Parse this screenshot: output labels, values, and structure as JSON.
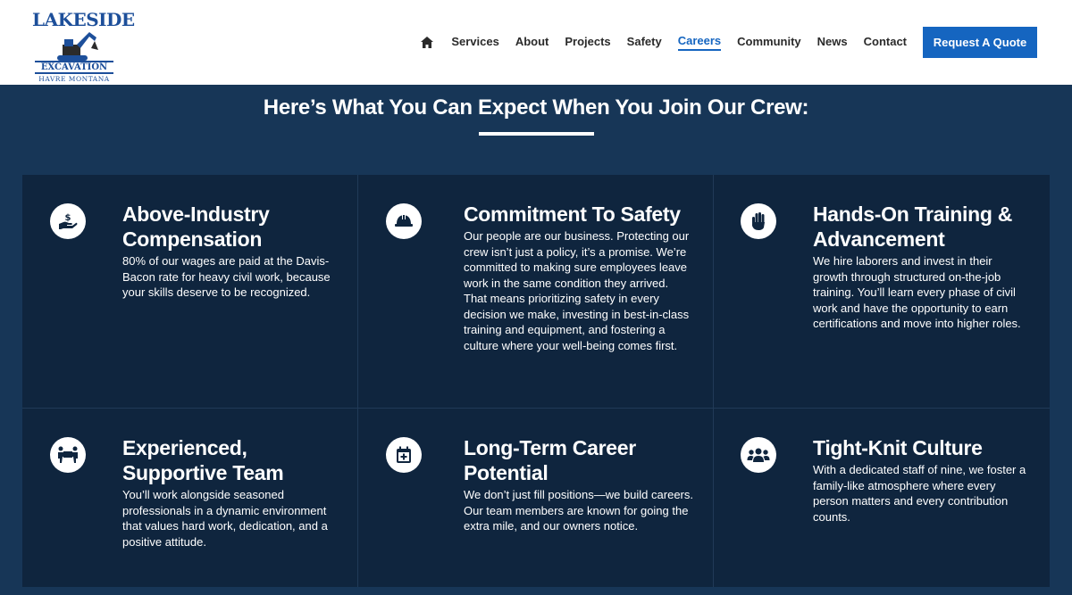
{
  "logo": {
    "top_text": "LAKESIDE",
    "band_text": "EXCAVATION",
    "sub_text": "HAVRE MONTANA"
  },
  "nav": {
    "home_icon": "home-icon",
    "items": [
      {
        "label": "Services"
      },
      {
        "label": "About"
      },
      {
        "label": "Projects"
      },
      {
        "label": "Safety"
      },
      {
        "label": "Careers",
        "active": true
      },
      {
        "label": "Community"
      },
      {
        "label": "News"
      },
      {
        "label": "Contact"
      }
    ],
    "cta": "Request A Quote"
  },
  "section": {
    "title": "Here’s What You Can Expect When You Join Our Crew:"
  },
  "cards": [
    {
      "icon": "hand-dollar-icon",
      "title": "Above-Industry Compensation",
      "text": "80% of our wages are paid at the Davis-Bacon rate for heavy civil work, because your skills deserve to be recognized."
    },
    {
      "icon": "hard-hat-icon",
      "title": "Commitment To Safety",
      "text": "Our people are our business. Protecting our crew isn’t just a policy, it’s a promise. We’re committed to making sure employees leave work in the same condition they arrived. That means prioritizing safety in every decision we make, investing in best-in-class training and equipment, and fostering a culture where your well-being comes first."
    },
    {
      "icon": "raised-hand-icon",
      "title": "Hands-On Training & Advancement",
      "text": "We hire laborers and invest in their growth through structured on-the-job training. You’ll learn every phase of civil work and have the opportunity to earn certifications and move into higher roles."
    },
    {
      "icon": "people-carry-icon",
      "title": "Experienced, Supportive Team",
      "text": "You’ll work alongside seasoned professionals in a dynamic environment that values hard work, dedication, and a positive attitude."
    },
    {
      "icon": "calendar-plus-icon",
      "title": "Long-Term Career Potential",
      "text": "We don’t just fill positions—we build careers. Our team members are known for going the extra mile, and our owners notice."
    },
    {
      "icon": "users-icon",
      "title": "Tight-Knit Culture",
      "text": "With a dedicated staff of nine, we foster a family-like atmosphere where every person matters and every contribution counts."
    }
  ],
  "colors": {
    "brand_blue": "#1565c0",
    "section_bg": "#173657",
    "card_bg": "#0f253e",
    "logo_blue": "#1d4f9a"
  }
}
